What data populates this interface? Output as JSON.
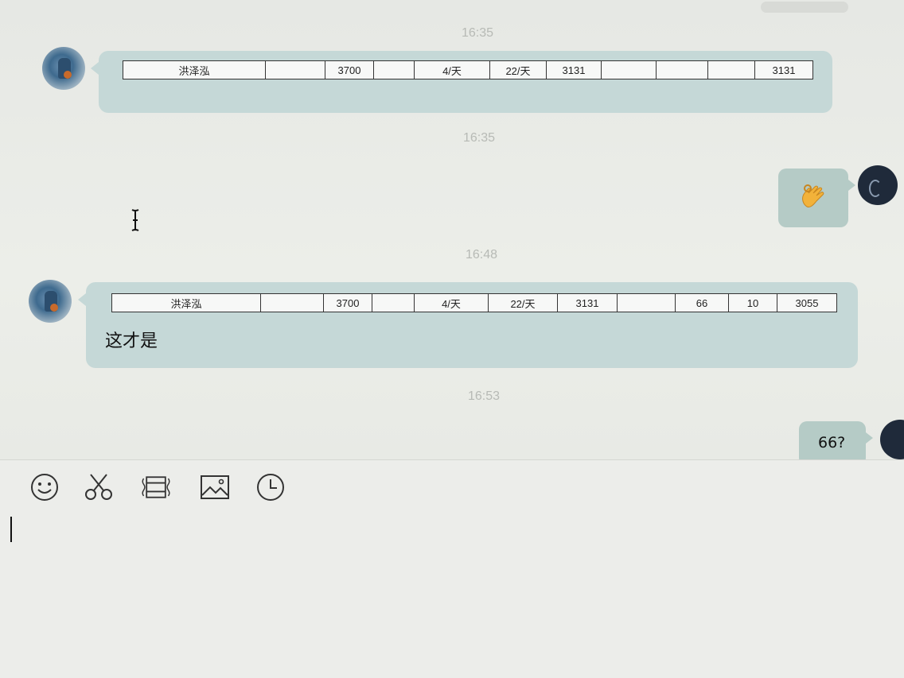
{
  "timestamps": [
    "16:35",
    "16:35",
    "16:48",
    "16:53"
  ],
  "messages": [
    {
      "from": "other",
      "table": [
        "洪泽泓",
        "",
        "3700",
        "",
        "4/天",
        "22/天",
        "3131",
        "",
        "",
        "",
        "3131"
      ]
    },
    {
      "from": "me",
      "emoji": "ok-hand"
    },
    {
      "from": "other",
      "table": [
        "洪泽泓",
        "",
        "3700",
        "",
        "4/天",
        "22/天",
        "3131",
        "",
        "66",
        "10",
        "3055"
      ],
      "text": "这才是"
    },
    {
      "from": "me",
      "text": "66?"
    }
  ],
  "toolbar": {
    "icons": [
      "emoji-icon",
      "scissors-icon",
      "shake-window-icon",
      "image-icon",
      "history-clock-icon"
    ]
  },
  "input": {
    "value": ""
  },
  "colors": {
    "incoming_bubble": "#c5d8d7",
    "outgoing_bubble": "#b5cbc6",
    "timestamp": "#b7bab5"
  }
}
